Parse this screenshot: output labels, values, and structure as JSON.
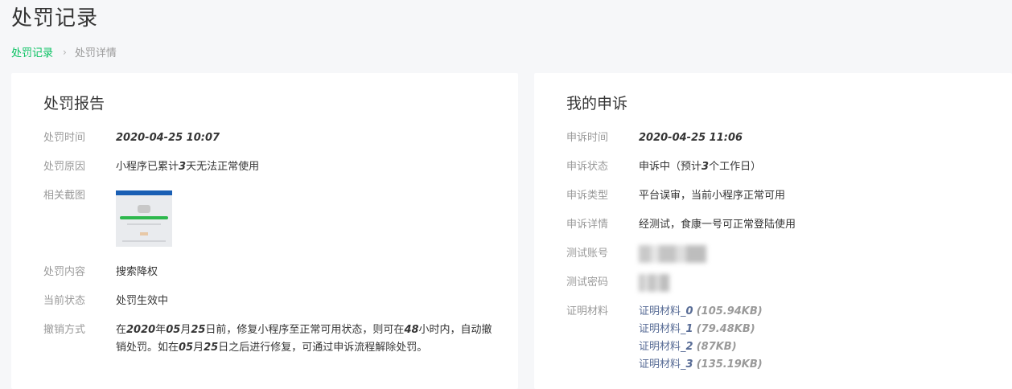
{
  "page": {
    "title": "处罚记录",
    "breadcrumb": {
      "link": "处罚记录",
      "sep": "›",
      "current": "处罚详情"
    }
  },
  "penalty_report": {
    "title": "处罚报告",
    "time_label": "处罚时间",
    "time_value": "2020-04-25 10:07",
    "reason_label": "处罚原因",
    "reason_prefix": "小程序已累计",
    "reason_num": "3",
    "reason_suffix": "天无法正常使用",
    "screenshot_label": "相关截图",
    "content_label": "处罚内容",
    "content_value": "搜索降权",
    "status_label": "当前状态",
    "status_value": "处罚生效中",
    "revoke_label": "撤销方式",
    "revoke_parts": {
      "p1": "在",
      "year": "2020",
      "p2": "年",
      "month": "05",
      "p3": "月",
      "day": "25",
      "p4": "日前，修复小程序至正常可用状态，则可在",
      "hours": "48",
      "p5": "小时内，自动撤销处罚。如在",
      "month2": "05",
      "p6": "月",
      "day2": "25",
      "p7": "日之后进行修复，可通过申诉流程解除处罚。"
    }
  },
  "appeal": {
    "title": "我的申诉",
    "time_label": "申诉时间",
    "time_value": "2020-04-25 11:06",
    "status_label": "申诉状态",
    "status_prefix": "申诉中（预计",
    "status_num": "3",
    "status_suffix": "个工作日）",
    "type_label": "申诉类型",
    "type_value": "平台误审，当前小程序正常可用",
    "detail_label": "申诉详情",
    "detail_value": "经测试，食康一号可正常登陆使用",
    "account_label": "测试账号",
    "password_label": "测试密码",
    "material_label": "证明材料",
    "files": [
      {
        "name": "证明材料_",
        "idx": "0",
        "size": "(105.94KB)"
      },
      {
        "name": "证明材料_",
        "idx": "1",
        "size": "(79.48KB)"
      },
      {
        "name": "证明材料_",
        "idx": "2",
        "size": "(87KB)"
      },
      {
        "name": "证明材料_",
        "idx": "3",
        "size": "(135.19KB)"
      }
    ]
  },
  "colors": {
    "accent": "#07c160",
    "link": "#576b95",
    "label": "#9a9a9a",
    "text": "#353535"
  }
}
